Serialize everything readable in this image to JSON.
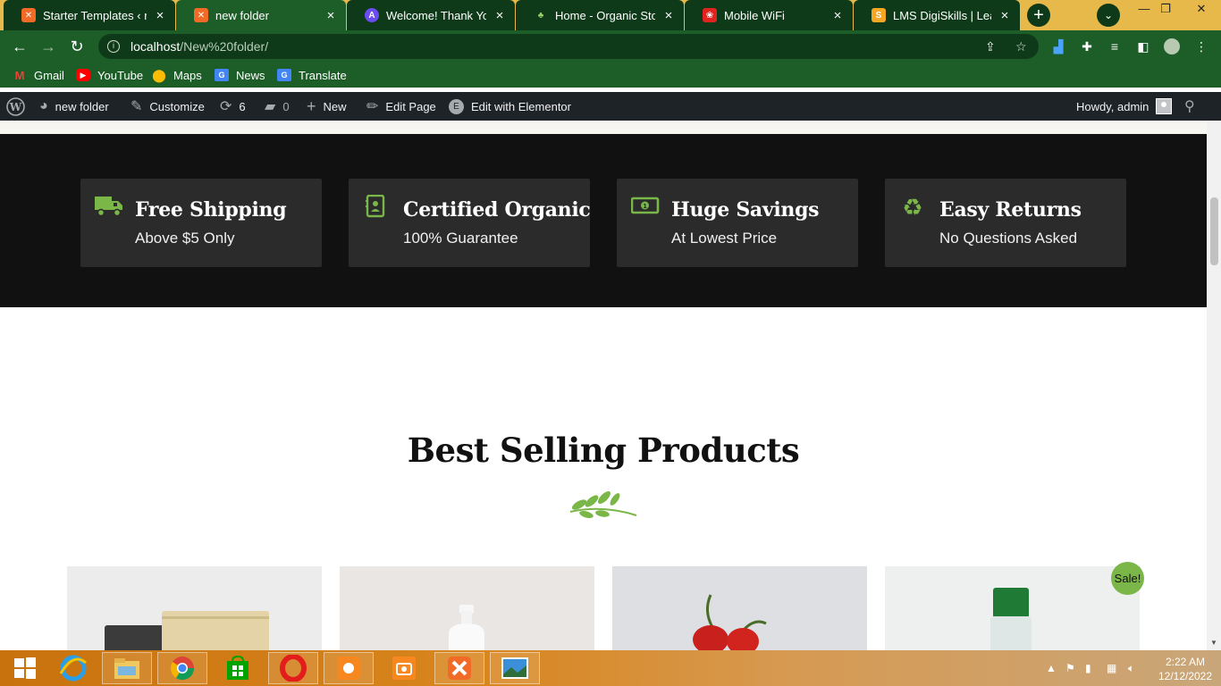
{
  "browser": {
    "tabs": [
      {
        "title": "Starter Templates ‹ new",
        "favicon": "xampp-icon",
        "active": false
      },
      {
        "title": "new folder",
        "favicon": "xampp-icon",
        "active": true
      },
      {
        "title": "Welcome! Thank You fo",
        "favicon": "astra-icon",
        "active": false
      },
      {
        "title": "Home - Organic Store",
        "favicon": "organic-store-icon",
        "active": false
      },
      {
        "title": "Mobile WiFi",
        "favicon": "huawei-icon",
        "active": false
      },
      {
        "title": "LMS DigiSkills | Learnin",
        "favicon": "digiskills-icon",
        "active": false
      }
    ],
    "url_host": "localhost",
    "url_path": "/New%20folder/",
    "bookmarks": [
      {
        "label": "Gmail",
        "icon": "gmail-icon"
      },
      {
        "label": "YouTube",
        "icon": "youtube-icon"
      },
      {
        "label": "Maps",
        "icon": "maps-icon"
      },
      {
        "label": "News",
        "icon": "news-icon"
      },
      {
        "label": "Translate",
        "icon": "translate-icon"
      }
    ]
  },
  "adminbar": {
    "site_name": "new folder",
    "customize": "Customize",
    "updates_count": "6",
    "comments_count": "0",
    "new_label": "New",
    "edit_page": "Edit Page",
    "edit_elementor": "Edit with Elementor",
    "howdy": "Howdy, admin"
  },
  "features": [
    {
      "title": "Free Shipping",
      "subtitle": "Above $5 Only",
      "icon": "truck-icon"
    },
    {
      "title": "Certified Organic",
      "subtitle": "100% Guarantee",
      "icon": "certificate-icon"
    },
    {
      "title": "Huge Savings",
      "subtitle": "At Lowest Price",
      "icon": "money-icon"
    },
    {
      "title": "Easy Returns",
      "subtitle": "No Questions Asked",
      "icon": "recycle-icon"
    }
  ],
  "section": {
    "title": "Best Selling Products",
    "sale_badge": "Sale!"
  },
  "colors": {
    "accent_green": "#7ab648",
    "dark_band": "#111111",
    "feature_box": "#2b2b2b",
    "browser_green": "#1d5d28",
    "admin_bar": "#1d2327"
  },
  "taskbar": {
    "time": "2:22 AM",
    "date": "12/12/2022"
  }
}
